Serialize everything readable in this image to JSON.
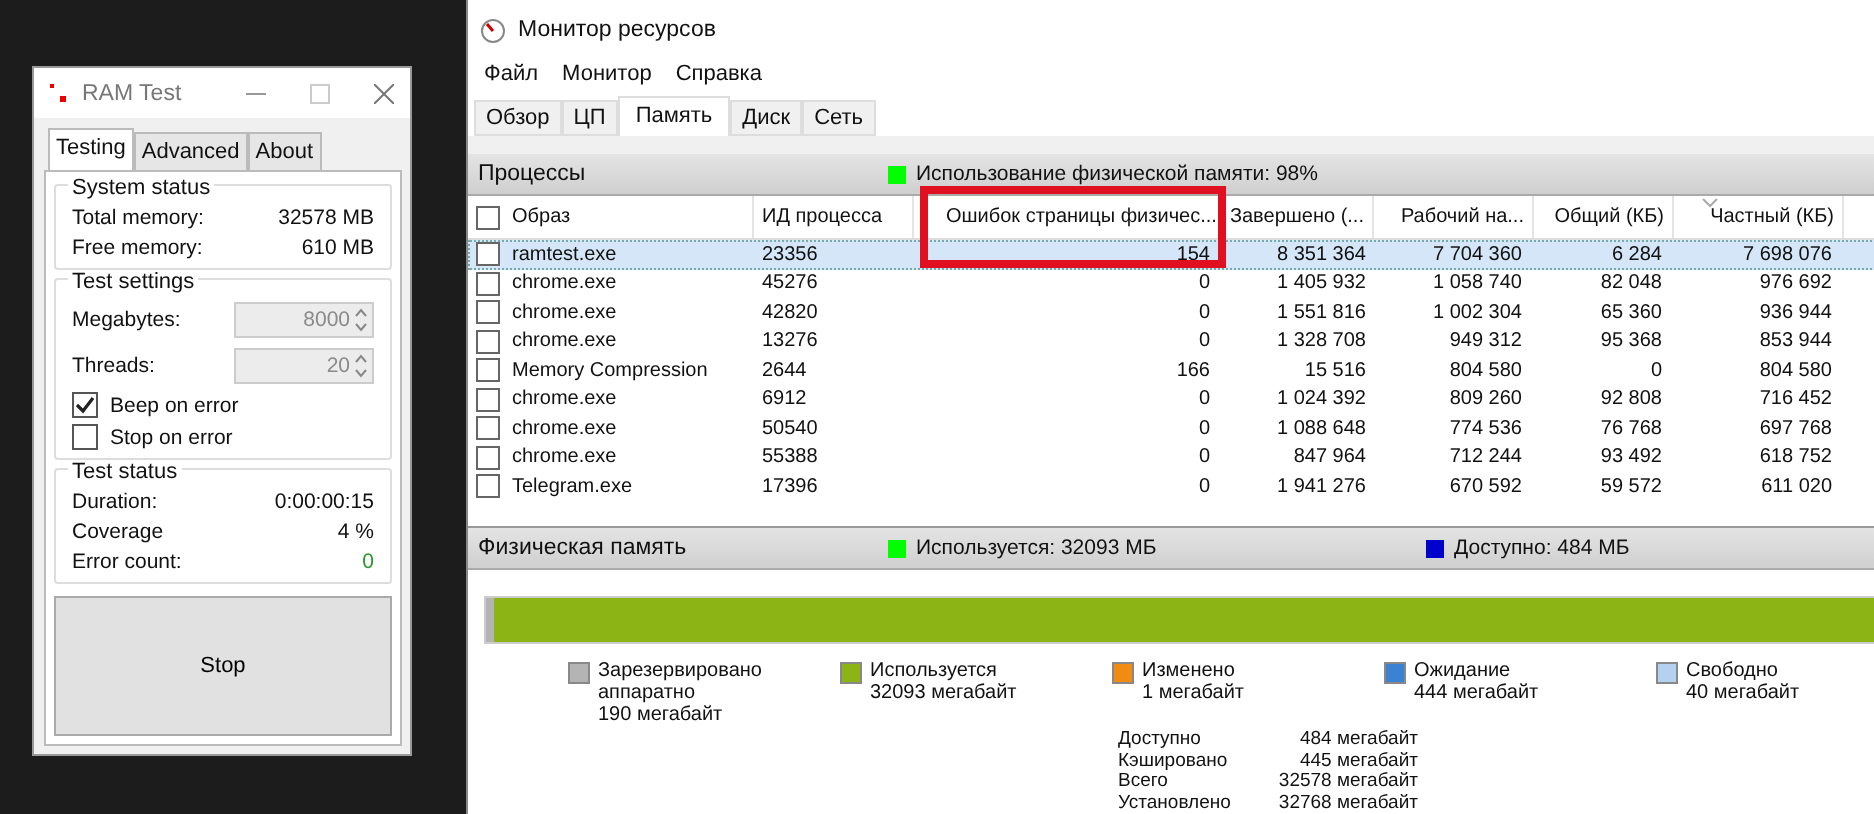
{
  "ram_test": {
    "title": "RAM Test",
    "tabs": [
      {
        "label": "Testing",
        "selected": true
      },
      {
        "label": "Advanced",
        "selected": false
      },
      {
        "label": "About",
        "selected": false
      }
    ],
    "system_status": {
      "title": "System status",
      "rows": [
        {
          "label": "Total memory:",
          "value": "32578 MB"
        },
        {
          "label": "Free memory:",
          "value": "610 MB"
        }
      ]
    },
    "test_settings": {
      "title": "Test settings",
      "fields": [
        {
          "label": "Megabytes:",
          "value": "8000",
          "disabled": true
        },
        {
          "label": "Threads:",
          "value": "20",
          "disabled": true
        }
      ],
      "checkboxes": [
        {
          "label": "Beep on error",
          "checked": true
        },
        {
          "label": "Stop on error",
          "checked": false
        }
      ]
    },
    "test_status": {
      "title": "Test status",
      "rows": [
        {
          "label": "Duration:",
          "value": "0:00:00:15",
          "kind": "plain"
        },
        {
          "label": "Coverage",
          "value": "4 %",
          "kind": "plain"
        },
        {
          "label": "Error count:",
          "value": "0",
          "kind": "ok"
        }
      ]
    },
    "button": "Stop"
  },
  "resource_monitor": {
    "title": "Монитор ресурсов",
    "menu": [
      "Файл",
      "Монитор",
      "Справка"
    ],
    "tabs": [
      {
        "label": "Обзор",
        "selected": false
      },
      {
        "label": "ЦП",
        "selected": false
      },
      {
        "label": "Память",
        "selected": true
      },
      {
        "label": "Диск",
        "selected": false
      },
      {
        "label": "Сеть",
        "selected": false
      }
    ],
    "processes": {
      "title": "Процессы",
      "summary": {
        "label": "Использование физической памяти: 98%",
        "color": "#00ff00"
      },
      "all_checked": false,
      "columns": [
        "Образ",
        "ИД процесса",
        "Ошибок страницы физичес...",
        "Завершено (...",
        "Рабочий на...",
        "Общий (КБ)",
        "Частный (КБ)"
      ],
      "rows": [
        {
          "selected": true,
          "checked": false,
          "cells": [
            "ramtest.exe",
            "23356",
            "154",
            "8 351 364",
            "7 704 360",
            "6 284",
            "7 698 076"
          ]
        },
        {
          "selected": false,
          "checked": false,
          "cells": [
            "chrome.exe",
            "45276",
            "0",
            "1 405 932",
            "1 058 740",
            "82 048",
            "976 692"
          ]
        },
        {
          "selected": false,
          "checked": false,
          "cells": [
            "chrome.exe",
            "42820",
            "0",
            "1 551 816",
            "1 002 304",
            "65 360",
            "936 944"
          ]
        },
        {
          "selected": false,
          "checked": false,
          "cells": [
            "chrome.exe",
            "13276",
            "0",
            "1 328 708",
            "949 312",
            "95 368",
            "853 944"
          ]
        },
        {
          "selected": false,
          "checked": false,
          "cells": [
            "Memory Compression",
            "2644",
            "166",
            "15 516",
            "804 580",
            "0",
            "804 580"
          ]
        },
        {
          "selected": false,
          "checked": false,
          "cells": [
            "chrome.exe",
            "6912",
            "0",
            "1 024 392",
            "809 260",
            "92 808",
            "716 452"
          ]
        },
        {
          "selected": false,
          "checked": false,
          "cells": [
            "chrome.exe",
            "50540",
            "0",
            "1 088 648",
            "774 536",
            "76 768",
            "697 768"
          ]
        },
        {
          "selected": false,
          "checked": false,
          "cells": [
            "chrome.exe",
            "55388",
            "0",
            "847 964",
            "712 244",
            "93 492",
            "618 752"
          ]
        },
        {
          "selected": false,
          "checked": false,
          "cells": [
            "Telegram.exe",
            "17396",
            "0",
            "1 941 276",
            "670 592",
            "59 572",
            "611 020"
          ]
        }
      ]
    },
    "physical_memory": {
      "title": "Физическая память",
      "in_use": {
        "label": "Используется: 32093 МБ",
        "color": "#00ff00"
      },
      "available": {
        "label": "Доступно: 484 МБ",
        "color": "#0000cc"
      },
      "legend": [
        {
          "label": "Зарезервировано аппаратно",
          "value": "190 мегабайт",
          "color": "#b4b4b4"
        },
        {
          "label": "Используется",
          "value": "32093 мегабайт",
          "color": "#8cb414"
        },
        {
          "label": "Изменено",
          "value": "1 мегабайт",
          "color": "#f08c14"
        },
        {
          "label": "Ожидание",
          "value": "444 мегабайт",
          "color": "#3c82d2"
        },
        {
          "label": "Свободно",
          "value": "40 мегабайт",
          "color": "#b4d2f0"
        }
      ],
      "stats": [
        {
          "label": "Доступно",
          "value": "484 мегабайт"
        },
        {
          "label": "Кэшировано",
          "value": "445 мегабайт"
        },
        {
          "label": "Всего",
          "value": "32578 мегабайт"
        },
        {
          "label": "Установлено",
          "value": "32768 мегабайт"
        }
      ]
    }
  }
}
